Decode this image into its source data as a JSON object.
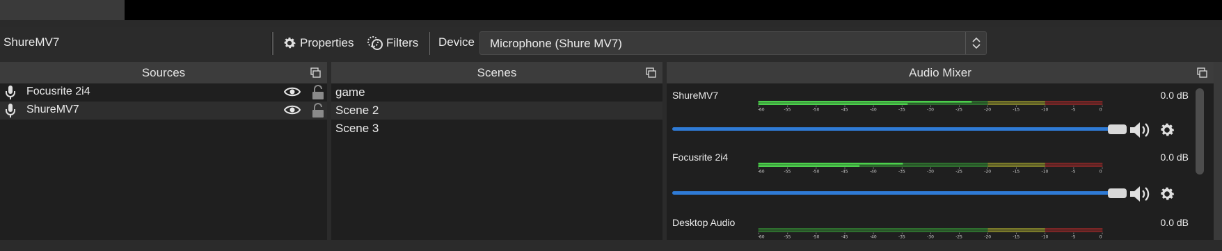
{
  "context_bar": {
    "source_name": "ShureMV7",
    "properties_label": "Properties",
    "filters_label": "Filters",
    "device_label": "Device",
    "device_value": "Microphone (Shure MV7)"
  },
  "sources": {
    "title": "Sources",
    "items": [
      {
        "label": "Focusrite 2i4"
      },
      {
        "label": "ShureMV7"
      }
    ]
  },
  "scenes": {
    "title": "Scenes",
    "items": [
      {
        "label": "game"
      },
      {
        "label": "Scene 2"
      },
      {
        "label": "Scene 3"
      }
    ]
  },
  "mixer": {
    "title": "Audio Mixer",
    "scale_labels": [
      "-60",
      "-55",
      "-50",
      "-45",
      "-40",
      "-35",
      "-30",
      "-25",
      "-20",
      "-15",
      "-10",
      "-5",
      "0"
    ],
    "channels": [
      {
        "name": "ShureMV7",
        "level": "0.0 dB",
        "volume": 1.0,
        "peak_fraction": 0.62
      },
      {
        "name": "Focusrite 2i4",
        "level": "0.0 dB",
        "volume": 1.0,
        "peak_fraction": 0.42
      },
      {
        "name": "Desktop Audio",
        "level": "0.0 dB",
        "volume": 1.0,
        "peak_fraction": 0.0
      }
    ]
  },
  "colors": {
    "meter_green": "#4cd14c",
    "meter_green_dim": "#2e6e2e",
    "meter_yellow_dim": "#7a7a2a",
    "meter_red_dim": "#7a2626",
    "slider_blue": "#2f7bd6"
  }
}
